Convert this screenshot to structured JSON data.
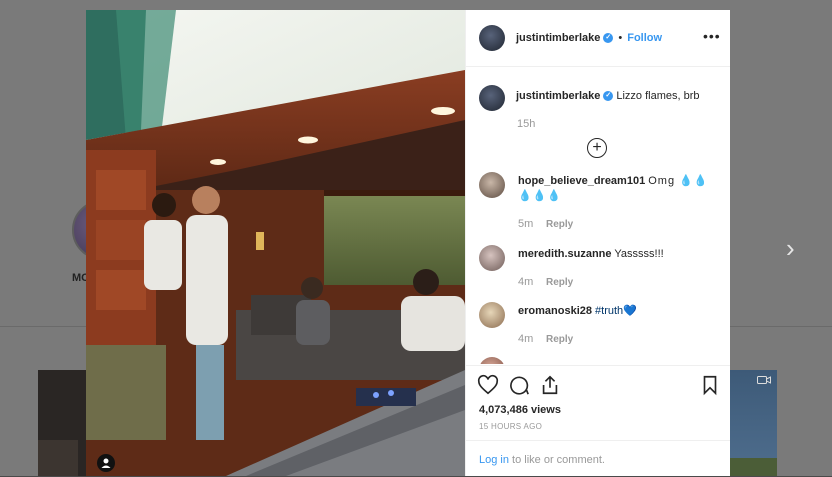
{
  "background": {
    "profile_name": "MO",
    "next_arrow": "›"
  },
  "post": {
    "author": "justintimberlake",
    "follow_label": "Follow",
    "dot": "•",
    "more_label": "•••",
    "caption": "Lizzo flames, brb",
    "caption_time": "15h",
    "load_more": "+",
    "comments": [
      {
        "user": "hope_believe_dream101",
        "text": "Omg 💧💧💧💧💧",
        "time": "5m",
        "reply": "Reply"
      },
      {
        "user": "meredith.suzanne",
        "text": "Yasssss!!!",
        "time": "4m",
        "reply": "Reply"
      },
      {
        "user": "eromanoski28",
        "text": "#truth💙",
        "time": "4m",
        "reply": "Reply"
      }
    ],
    "views": "4,073,486 views",
    "time_ago": "15 HOURS AGO",
    "login_link": "Log in",
    "login_text": " to like or comment."
  },
  "icons": {
    "verified": "verified-badge-icon",
    "like": "heart-icon",
    "comment": "comment-icon",
    "share": "share-icon",
    "save": "bookmark-icon",
    "video": "video-camera-icon",
    "user": "user-icon"
  },
  "colors": {
    "link": "#3897f0",
    "text": "#262626",
    "muted": "#999999",
    "overlay": "#7a7a7a"
  }
}
